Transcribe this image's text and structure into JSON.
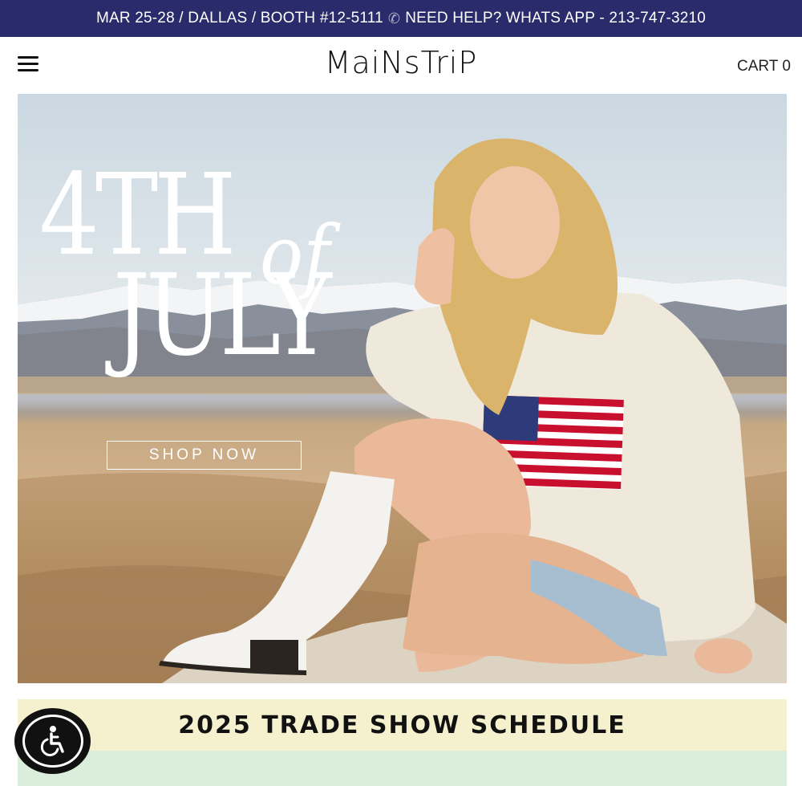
{
  "announcement": {
    "event_text": "MAR 25-28 / DALLAS / BOOTH #12-5111",
    "phone_icon": "phone-icon",
    "help_text": "NEED HELP? WHATS APP - 213-747-3210",
    "background": "#2a2b6b"
  },
  "header": {
    "menu_icon": "hamburger-menu-icon",
    "logo_text": "MaiNsTriP",
    "cart_label": "CART",
    "cart_count": "0"
  },
  "hero": {
    "title_line1": "4TH",
    "title_of": "of",
    "title_line2": "JULY",
    "cta_label": "SHOP NOW"
  },
  "schedule": {
    "title": "2025 TRADE SHOW SCHEDULE",
    "colors": {
      "top": "#f5f1cf",
      "bottom": "#dbeedb"
    }
  },
  "accessibility": {
    "icon": "accessibility-wheelchair-icon"
  }
}
